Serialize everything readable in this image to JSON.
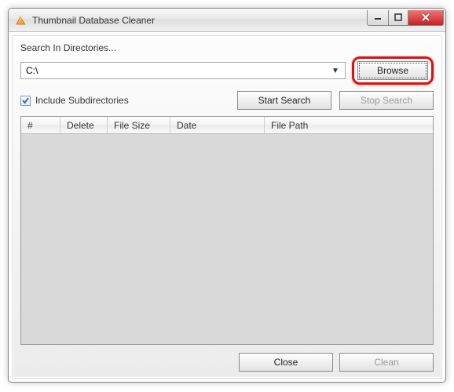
{
  "title": "Thumbnail Database Cleaner",
  "section_label": "Search In Directories...",
  "path_combo": {
    "value": "C:\\"
  },
  "buttons": {
    "browse": "Browse",
    "start_search": "Start Search",
    "stop_search": "Stop Search",
    "close": "Close",
    "clean": "Clean"
  },
  "checkbox": {
    "label": "Include Subdirectories",
    "checked": true
  },
  "table": {
    "columns": [
      "#",
      "Delete",
      "File Size",
      "Date",
      "File Path"
    ],
    "rows": []
  }
}
